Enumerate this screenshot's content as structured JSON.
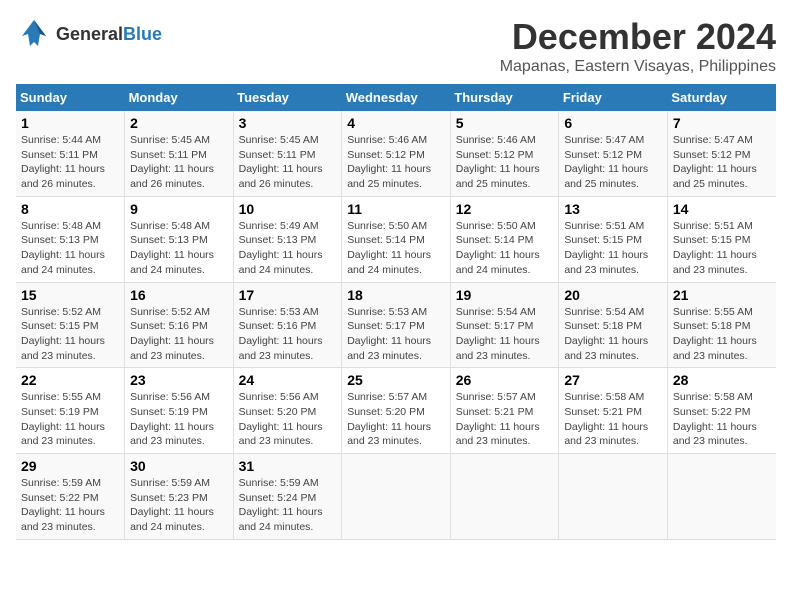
{
  "logo": {
    "general": "General",
    "blue": "Blue"
  },
  "title": {
    "month": "December 2024",
    "location": "Mapanas, Eastern Visayas, Philippines"
  },
  "headers": [
    "Sunday",
    "Monday",
    "Tuesday",
    "Wednesday",
    "Thursday",
    "Friday",
    "Saturday"
  ],
  "weeks": [
    [
      {
        "day": "1",
        "sunrise": "5:44 AM",
        "sunset": "5:11 PM",
        "daylight": "11 hours and 26 minutes."
      },
      {
        "day": "2",
        "sunrise": "5:45 AM",
        "sunset": "5:11 PM",
        "daylight": "11 hours and 26 minutes."
      },
      {
        "day": "3",
        "sunrise": "5:45 AM",
        "sunset": "5:11 PM",
        "daylight": "11 hours and 26 minutes."
      },
      {
        "day": "4",
        "sunrise": "5:46 AM",
        "sunset": "5:12 PM",
        "daylight": "11 hours and 25 minutes."
      },
      {
        "day": "5",
        "sunrise": "5:46 AM",
        "sunset": "5:12 PM",
        "daylight": "11 hours and 25 minutes."
      },
      {
        "day": "6",
        "sunrise": "5:47 AM",
        "sunset": "5:12 PM",
        "daylight": "11 hours and 25 minutes."
      },
      {
        "day": "7",
        "sunrise": "5:47 AM",
        "sunset": "5:12 PM",
        "daylight": "11 hours and 25 minutes."
      }
    ],
    [
      {
        "day": "8",
        "sunrise": "5:48 AM",
        "sunset": "5:13 PM",
        "daylight": "11 hours and 24 minutes."
      },
      {
        "day": "9",
        "sunrise": "5:48 AM",
        "sunset": "5:13 PM",
        "daylight": "11 hours and 24 minutes."
      },
      {
        "day": "10",
        "sunrise": "5:49 AM",
        "sunset": "5:13 PM",
        "daylight": "11 hours and 24 minutes."
      },
      {
        "day": "11",
        "sunrise": "5:50 AM",
        "sunset": "5:14 PM",
        "daylight": "11 hours and 24 minutes."
      },
      {
        "day": "12",
        "sunrise": "5:50 AM",
        "sunset": "5:14 PM",
        "daylight": "11 hours and 24 minutes."
      },
      {
        "day": "13",
        "sunrise": "5:51 AM",
        "sunset": "5:15 PM",
        "daylight": "11 hours and 23 minutes."
      },
      {
        "day": "14",
        "sunrise": "5:51 AM",
        "sunset": "5:15 PM",
        "daylight": "11 hours and 23 minutes."
      }
    ],
    [
      {
        "day": "15",
        "sunrise": "5:52 AM",
        "sunset": "5:15 PM",
        "daylight": "11 hours and 23 minutes."
      },
      {
        "day": "16",
        "sunrise": "5:52 AM",
        "sunset": "5:16 PM",
        "daylight": "11 hours and 23 minutes."
      },
      {
        "day": "17",
        "sunrise": "5:53 AM",
        "sunset": "5:16 PM",
        "daylight": "11 hours and 23 minutes."
      },
      {
        "day": "18",
        "sunrise": "5:53 AM",
        "sunset": "5:17 PM",
        "daylight": "11 hours and 23 minutes."
      },
      {
        "day": "19",
        "sunrise": "5:54 AM",
        "sunset": "5:17 PM",
        "daylight": "11 hours and 23 minutes."
      },
      {
        "day": "20",
        "sunrise": "5:54 AM",
        "sunset": "5:18 PM",
        "daylight": "11 hours and 23 minutes."
      },
      {
        "day": "21",
        "sunrise": "5:55 AM",
        "sunset": "5:18 PM",
        "daylight": "11 hours and 23 minutes."
      }
    ],
    [
      {
        "day": "22",
        "sunrise": "5:55 AM",
        "sunset": "5:19 PM",
        "daylight": "11 hours and 23 minutes."
      },
      {
        "day": "23",
        "sunrise": "5:56 AM",
        "sunset": "5:19 PM",
        "daylight": "11 hours and 23 minutes."
      },
      {
        "day": "24",
        "sunrise": "5:56 AM",
        "sunset": "5:20 PM",
        "daylight": "11 hours and 23 minutes."
      },
      {
        "day": "25",
        "sunrise": "5:57 AM",
        "sunset": "5:20 PM",
        "daylight": "11 hours and 23 minutes."
      },
      {
        "day": "26",
        "sunrise": "5:57 AM",
        "sunset": "5:21 PM",
        "daylight": "11 hours and 23 minutes."
      },
      {
        "day": "27",
        "sunrise": "5:58 AM",
        "sunset": "5:21 PM",
        "daylight": "11 hours and 23 minutes."
      },
      {
        "day": "28",
        "sunrise": "5:58 AM",
        "sunset": "5:22 PM",
        "daylight": "11 hours and 23 minutes."
      }
    ],
    [
      {
        "day": "29",
        "sunrise": "5:59 AM",
        "sunset": "5:22 PM",
        "daylight": "11 hours and 23 minutes."
      },
      {
        "day": "30",
        "sunrise": "5:59 AM",
        "sunset": "5:23 PM",
        "daylight": "11 hours and 24 minutes."
      },
      {
        "day": "31",
        "sunrise": "5:59 AM",
        "sunset": "5:24 PM",
        "daylight": "11 hours and 24 minutes."
      },
      null,
      null,
      null,
      null
    ]
  ]
}
